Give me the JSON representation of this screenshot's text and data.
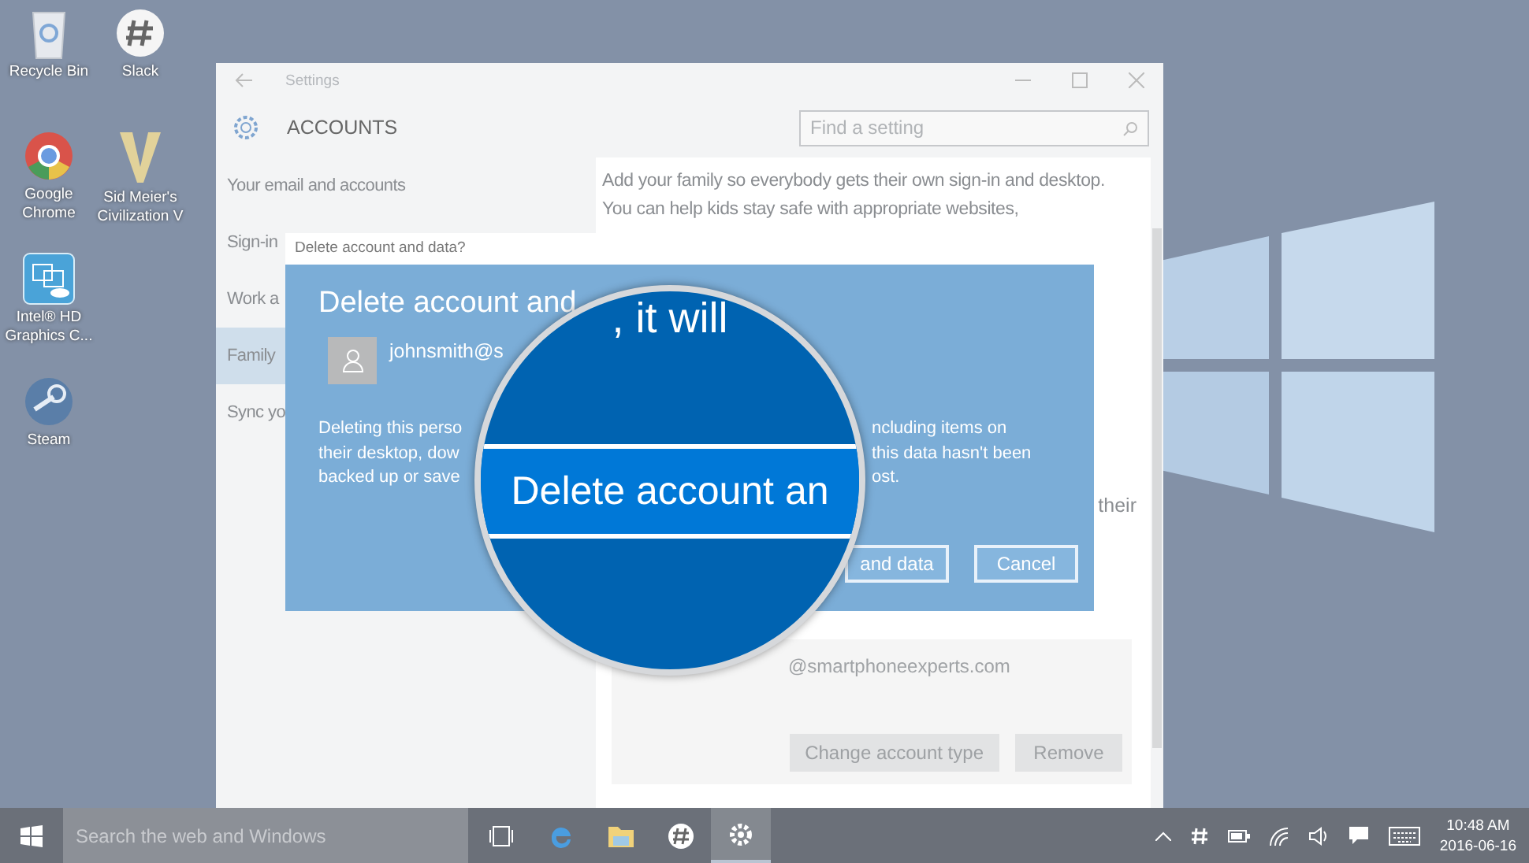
{
  "desktop": {
    "icons": [
      {
        "kind": "recycle",
        "label": "Recycle Bin"
      },
      {
        "kind": "slack",
        "label": "Slack"
      },
      {
        "kind": "chrome",
        "label": "Google Chrome"
      },
      {
        "kind": "civ",
        "label": "Sid Meier's Civilization V"
      },
      {
        "kind": "intel",
        "label": "Intel® HD Graphics C..."
      },
      {
        "kind": "steam",
        "label": "Steam"
      }
    ]
  },
  "settings_window": {
    "title": "Settings",
    "header": "ACCOUNTS",
    "search": {
      "placeholder": "Find a setting"
    },
    "nav": [
      {
        "label": "Your email and accounts",
        "selected": false
      },
      {
        "label": "Sign-in",
        "selected": false
      },
      {
        "label": "Work a",
        "selected": false
      },
      {
        "label": "Family",
        "selected": true
      },
      {
        "label": "Sync yo",
        "selected": false
      }
    ],
    "content": {
      "intro": "Add your family so everybody gets their own sign-in and desktop. You can help kids stay safe with appropriate websites,",
      "fragment": "their",
      "account": {
        "email": "@smartphoneexperts.com",
        "buttons": [
          "Change account type",
          "Remove"
        ]
      }
    }
  },
  "dialog": {
    "title": "Delete account and data?",
    "heading": "Delete account and",
    "user": "johnsmith@s",
    "body_left": [
      "Deleting this perso",
      "their desktop, dow",
      "backed up or save"
    ],
    "body_right": [
      "ncluding items on",
      "this data hasn't been",
      "ost."
    ],
    "buttons": [
      "and data",
      "Cancel"
    ]
  },
  "magnifier": {
    "top_text": ", it will",
    "band_text": "Delete account an"
  },
  "taskbar": {
    "search": {
      "placeholder": "Search the web and Windows"
    },
    "apps": [
      {
        "kind": "taskview",
        "selected": false
      },
      {
        "kind": "edge",
        "selected": false
      },
      {
        "kind": "explorer",
        "selected": false
      },
      {
        "kind": "slack",
        "selected": false
      },
      {
        "kind": "settings",
        "selected": true
      }
    ],
    "time": "10:48 AM",
    "date": "2016-06-16"
  }
}
